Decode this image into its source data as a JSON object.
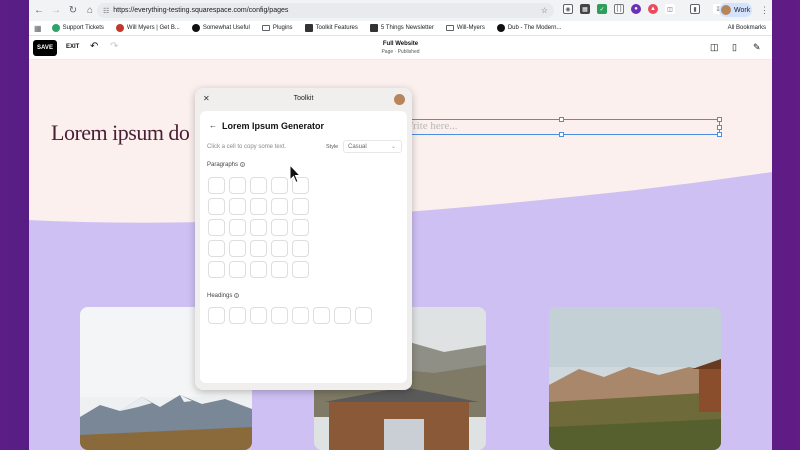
{
  "browser": {
    "url": "https://everything-testing.squarespace.com/config/pages",
    "profile_label": "Work",
    "bookmarks": [
      {
        "label": "Support Tickets"
      },
      {
        "label": "Will Myers | Get B..."
      },
      {
        "label": "Somewhat Useful"
      },
      {
        "label": "Plugins"
      },
      {
        "label": "Toolkit Features"
      },
      {
        "label": "5 Things Newsletter"
      },
      {
        "label": "Will-Myers"
      },
      {
        "label": "Dub - The Modern..."
      }
    ],
    "all_bookmarks_label": "All Bookmarks"
  },
  "editor": {
    "save_label": "SAVE",
    "exit_label": "EXIT",
    "site_title": "Full Website",
    "site_status": "Page · Published"
  },
  "page": {
    "hero_title": "Lorem ipsum do",
    "text_placeholder": "Write here...",
    "colors": {
      "top_bg": "#fbf0ee",
      "lavender": "#cfc0f3",
      "selection": "#4a90e2"
    }
  },
  "toolkit": {
    "title": "Toolkit",
    "heading": "Lorem Ipsum Generator",
    "hint": "Click a cell to copy some text.",
    "style_label": "Style",
    "style_value": "Casual",
    "paragraphs_label": "Paragraphs",
    "headings_label": "Headings"
  }
}
